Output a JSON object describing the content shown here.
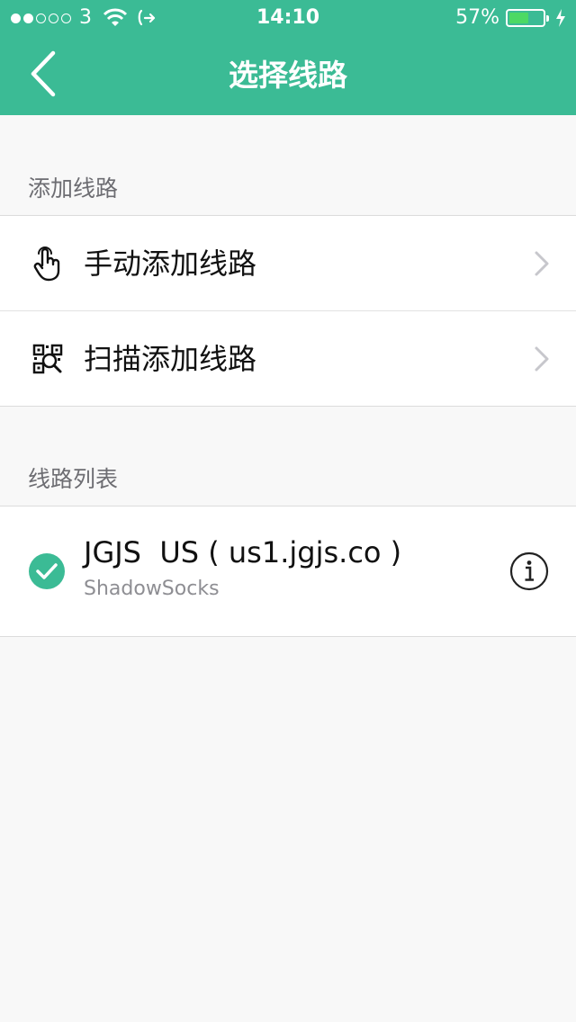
{
  "status_bar": {
    "carrier": "3",
    "time": "14:10",
    "battery_percent": "57%",
    "battery_level": 0.57,
    "signal_bars_filled": 2,
    "signal_bars_total": 5,
    "icons": [
      "signal-dots-icon",
      "wifi-icon",
      "call-forward-icon",
      "battery-icon",
      "charging-bolt-icon"
    ]
  },
  "navbar": {
    "title": "选择线路",
    "back_icon": "back-chevron-icon"
  },
  "add_section": {
    "header": "添加线路",
    "items": [
      {
        "label": "手动添加线路",
        "icon": "hand-pointer-icon"
      },
      {
        "label": "扫描添加线路",
        "icon": "qr-scan-icon"
      }
    ]
  },
  "list_section": {
    "header": "线路列表",
    "servers": [
      {
        "title": "JGJS  US ( us1.jgjs.co )",
        "subtitle": "ShadowSocks",
        "selected": true,
        "info_icon": "info-icon"
      }
    ]
  },
  "colors": {
    "accent": "#3bbb95",
    "background": "#f8f8f8",
    "battery_fill": "#4cd964",
    "chevron": "#c7c7cc"
  }
}
